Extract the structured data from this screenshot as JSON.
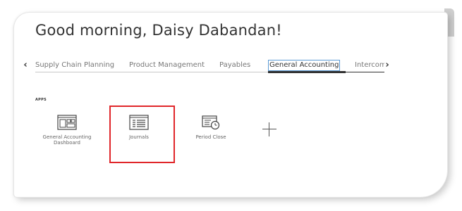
{
  "greeting": "Good morning, Daisy Dabandan!",
  "tabs": [
    {
      "label": "Supply Chain Planning"
    },
    {
      "label": "Product Management"
    },
    {
      "label": "Payables"
    },
    {
      "label": "General Accounting"
    },
    {
      "label": "Intercompany"
    }
  ],
  "active_tab": "General Accounting",
  "section_label": "APPS",
  "apps": [
    {
      "label": "General Accounting Dashboard",
      "icon": "dashboard-icon"
    },
    {
      "label": "Journals",
      "icon": "journals-icon"
    },
    {
      "label": "Period Close",
      "icon": "period-close-icon"
    }
  ],
  "add_icon": "plus-icon",
  "colors": {
    "highlight": "#e0262a",
    "active_tab_border": "#5b9bd5",
    "text_dark": "#333333",
    "text_muted": "#777777"
  }
}
